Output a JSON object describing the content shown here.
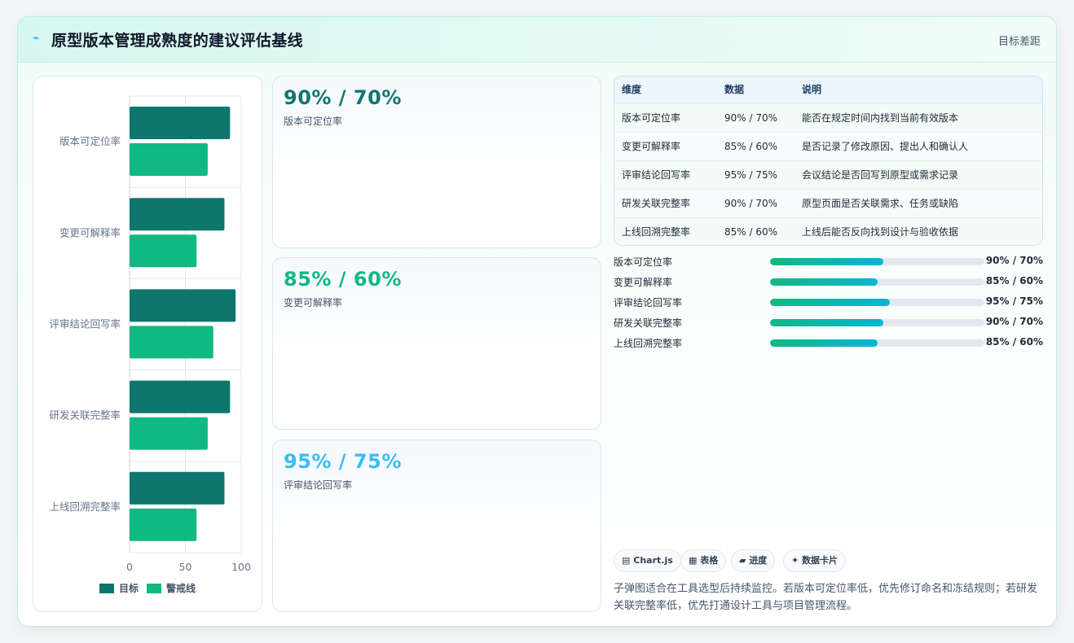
{
  "header": {
    "icon": "bolt-icon",
    "title": "原型版本管理成熟度的建议评估基线",
    "tag": "目标差距"
  },
  "chart_data": {
    "type": "bar",
    "orientation": "horizontal",
    "categories": [
      "版本可定位率",
      "变更可解释率",
      "评审结论回写率",
      "研发关联完整率",
      "上线回溯完整率"
    ],
    "series": [
      {
        "name": "目标",
        "values": [
          90,
          85,
          95,
          90,
          85
        ],
        "color": "#0f766e"
      },
      {
        "name": "警戒线",
        "values": [
          70,
          60,
          75,
          70,
          60
        ],
        "color": "#10b981"
      }
    ],
    "xlim": [
      0,
      100
    ],
    "xticks": [
      "0",
      "50",
      "100"
    ],
    "legend": "bottom",
    "grid": true
  },
  "stats": [
    {
      "value": "90% / 70%",
      "label": "版本可定位率",
      "color": "#0f766e"
    },
    {
      "value": "85% / 60%",
      "label": "变更可解释率",
      "color": "#10b981"
    },
    {
      "value": "95% / 75%",
      "label": "评审结论回写率",
      "color": "#38bdf8"
    }
  ],
  "table": {
    "headers": [
      "维度",
      "数据",
      "说明"
    ],
    "rows": [
      [
        "版本可定位率",
        "90% / 70%",
        "能否在规定时间内找到当前有效版本"
      ],
      [
        "变更可解释率",
        "85% / 60%",
        "是否记录了修改原因、提出人和确认人"
      ],
      [
        "评审结论回写率",
        "95% / 75%",
        "会议结论是否回写到原型或需求记录"
      ],
      [
        "研发关联完整率",
        "90% / 70%",
        "原型页面是否关联需求、任务或缺陷"
      ],
      [
        "上线回溯完整率",
        "85% / 60%",
        "上线后能否反向找到设计与验收依据"
      ]
    ]
  },
  "progress": [
    {
      "label": "版本可定位率",
      "value": "90% / 70%",
      "fraction": 0.53
    },
    {
      "label": "变更可解释率",
      "value": "85% / 60%",
      "fraction": 0.5
    },
    {
      "label": "评审结论回写率",
      "value": "95% / 75%",
      "fraction": 0.56
    },
    {
      "label": "研发关联完整率",
      "value": "90% / 70%",
      "fraction": 0.53
    },
    {
      "label": "上线回溯完整率",
      "value": "85% / 60%",
      "fraction": 0.5
    }
  ],
  "chips": [
    {
      "icon": "chart-icon",
      "glyph": "▤",
      "label": "Chart.js"
    },
    {
      "icon": "table-icon",
      "glyph": "▦",
      "label": "表格"
    },
    {
      "icon": "progress-icon",
      "glyph": "▰",
      "label": "进度"
    },
    {
      "icon": "card-icon",
      "glyph": "✦",
      "label": "数据卡片"
    }
  ],
  "note": "子弹图适合在工具选型后持续监控。若版本可定位率低，优先修订命名和冻结规则；若研发关联完整率低，优先打通设计工具与项目管理流程。"
}
